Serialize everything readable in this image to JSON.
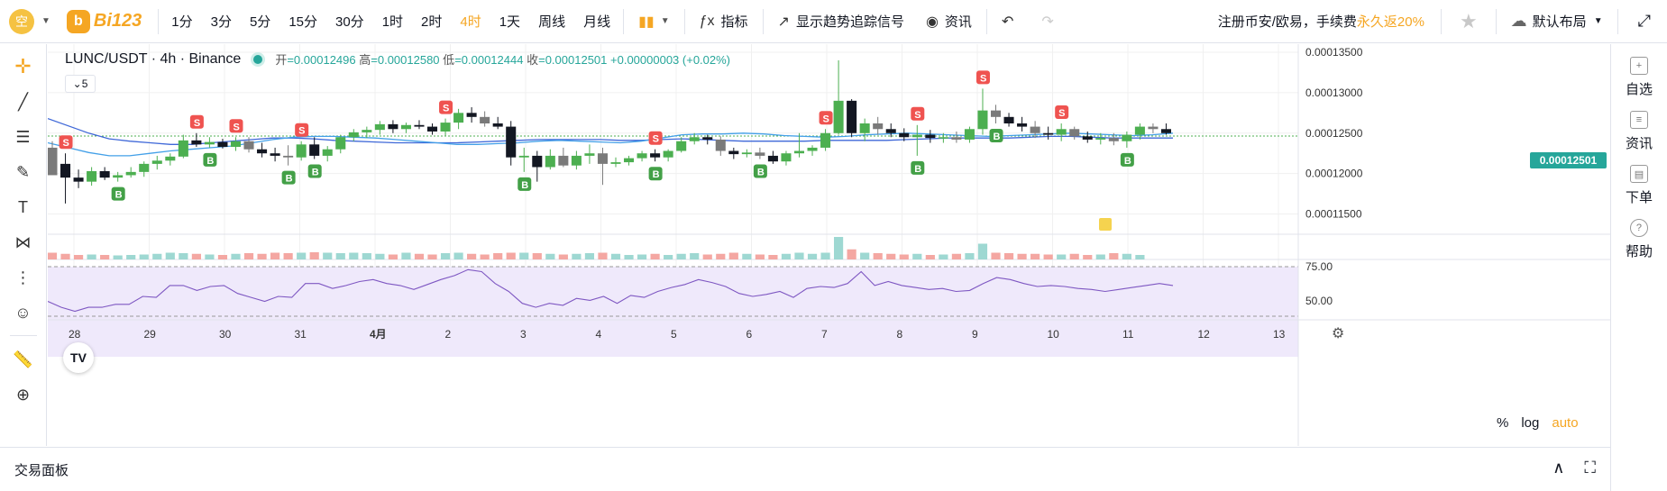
{
  "topbar": {
    "avatar_char": "空",
    "logo_badge": "b",
    "logo_text": "Bi123",
    "intervals": [
      "1分",
      "3分",
      "5分",
      "15分",
      "30分",
      "1时",
      "2时",
      "4时",
      "1天",
      "周线",
      "月线"
    ],
    "active_interval": "4时",
    "indicators_label": "指标",
    "trend_signal_label": "显示趋势追踪信号",
    "news_label": "资讯",
    "promo_text": "注册币安/欧易，手续费",
    "promo_highlight": "永久返20%",
    "layout_label": "默认布局"
  },
  "right_panel": {
    "items": [
      {
        "icon": "add-icon",
        "label": "自选"
      },
      {
        "icon": "news-icon",
        "label": "资讯"
      },
      {
        "icon": "order-icon",
        "label": "下单"
      },
      {
        "icon": "help-icon",
        "label": "帮助"
      }
    ]
  },
  "legend": {
    "symbol": "LUNC/USDT · 4h · Binance",
    "open_label": "开",
    "open": "=0.00012496",
    "high_label": "高",
    "high": "=0.00012580",
    "low_label": "低",
    "low": "=0.00012444",
    "close_label": "收",
    "close": "=0.00012501",
    "change": "+0.00000003 (+0.02%)",
    "ma_toggle": "5"
  },
  "current_price": "0.00012501",
  "bottom": {
    "panel_title": "交易面板",
    "scale_percent": "%",
    "scale_log": "log",
    "scale_auto": "auto",
    "tv_logo": "TV"
  },
  "colors": {
    "up": "#4caf50",
    "down": "#131722",
    "neutral": "#7a7a7a",
    "accent": "#f5a623",
    "sell_badge": "#ef5350",
    "buy_badge": "#43a047"
  },
  "chart_data": {
    "type": "candlestick",
    "symbol": "LUNC/USDT",
    "interval": "4h",
    "exchange": "Binance",
    "price_ticks": [
      "0.00013500",
      "0.00013000",
      "0.00012500",
      "0.00012000",
      "0.00011500"
    ],
    "price_tick_values": [
      0.000135,
      0.00013,
      0.000125,
      0.00012,
      0.000115
    ],
    "rsi_ticks": [
      "75.00",
      "50.00"
    ],
    "x_tick_labels": [
      "28",
      "29",
      "30",
      "31",
      "4月",
      "2",
      "3",
      "4",
      "5",
      "6",
      "7",
      "8",
      "9",
      "10",
      "11",
      "12",
      "13"
    ],
    "ylim": [
      0.0001125,
      0.000136
    ],
    "candles": [
      [
        0.0001232,
        0.000124,
        0.0001212,
        0.0001198
      ],
      [
        0.0001212,
        0.0001225,
        0.0001163,
        0.0001195
      ],
      [
        0.0001195,
        0.0001205,
        0.0001182,
        0.000119
      ],
      [
        0.000119,
        0.0001208,
        0.0001185,
        0.0001203
      ],
      [
        0.0001203,
        0.0001208,
        0.0001192,
        0.0001195
      ],
      [
        0.0001195,
        0.0001202,
        0.000119,
        0.0001198
      ],
      [
        0.0001198,
        0.0001208,
        0.0001195,
        0.0001202
      ],
      [
        0.0001202,
        0.0001215,
        0.0001196,
        0.0001212
      ],
      [
        0.0001212,
        0.0001222,
        0.0001205,
        0.0001216
      ],
      [
        0.0001216,
        0.0001225,
        0.000121,
        0.0001221
      ],
      [
        0.0001221,
        0.0001248,
        0.0001219,
        0.0001241
      ],
      [
        0.0001241,
        0.000125,
        0.0001233,
        0.0001236
      ],
      [
        0.0001236,
        0.0001245,
        0.0001232,
        0.0001239
      ],
      [
        0.0001239,
        0.0001243,
        0.0001231,
        0.0001233
      ],
      [
        0.0001233,
        0.0001245,
        0.0001228,
        0.000124
      ],
      [
        0.000124,
        0.0001245,
        0.0001226,
        0.000123
      ],
      [
        0.000123,
        0.0001238,
        0.000122,
        0.0001225
      ],
      [
        0.0001225,
        0.0001232,
        0.0001215,
        0.0001222
      ],
      [
        0.0001222,
        0.0001235,
        0.000121,
        0.000122
      ],
      [
        0.000122,
        0.000124,
        0.0001216,
        0.0001236
      ],
      [
        0.0001236,
        0.0001245,
        0.0001218,
        0.0001222
      ],
      [
        0.0001222,
        0.0001234,
        0.0001215,
        0.000123
      ],
      [
        0.000123,
        0.0001248,
        0.0001225,
        0.0001245
      ],
      [
        0.0001245,
        0.0001255,
        0.000124,
        0.0001251
      ],
      [
        0.0001251,
        0.0001258,
        0.0001244,
        0.0001254
      ],
      [
        0.0001254,
        0.0001265,
        0.0001248,
        0.0001261
      ],
      [
        0.0001261,
        0.0001266,
        0.000125,
        0.0001255
      ],
      [
        0.0001255,
        0.0001263,
        0.000125,
        0.000126
      ],
      [
        0.000126,
        0.0001266,
        0.0001255,
        0.0001258
      ],
      [
        0.0001258,
        0.0001262,
        0.0001248,
        0.0001252
      ],
      [
        0.0001252,
        0.0001268,
        0.0001247,
        0.0001263
      ],
      [
        0.0001263,
        0.000128,
        0.0001255,
        0.0001275
      ],
      [
        0.0001275,
        0.0001282,
        0.0001263,
        0.000127
      ],
      [
        0.000127,
        0.0001277,
        0.0001258,
        0.0001262
      ],
      [
        0.0001262,
        0.000127,
        0.0001255,
        0.0001258
      ],
      [
        0.0001258,
        0.0001265,
        0.000121,
        0.000122
      ],
      [
        0.000122,
        0.0001232,
        0.0001202,
        0.0001222
      ],
      [
        0.0001222,
        0.0001228,
        0.000119,
        0.0001208
      ],
      [
        0.0001208,
        0.000123,
        0.0001205,
        0.0001222
      ],
      [
        0.0001222,
        0.0001232,
        0.0001208,
        0.000121
      ],
      [
        0.000121,
        0.0001228,
        0.0001205,
        0.0001222
      ],
      [
        0.0001222,
        0.0001236,
        0.0001212,
        0.0001225
      ],
      [
        0.0001225,
        0.0001232,
        0.0001186,
        0.0001212
      ],
      [
        0.0001212,
        0.000122,
        0.0001208,
        0.0001214
      ],
      [
        0.0001214,
        0.0001222,
        0.000121,
        0.0001219
      ],
      [
        0.0001219,
        0.0001228,
        0.0001215,
        0.0001225
      ],
      [
        0.0001225,
        0.000123,
        0.0001215,
        0.000122
      ],
      [
        0.000122,
        0.000123,
        0.0001215,
        0.0001228
      ],
      [
        0.0001228,
        0.0001245,
        0.0001226,
        0.000124
      ],
      [
        0.000124,
        0.000125,
        0.0001236,
        0.0001245
      ],
      [
        0.0001245,
        0.0001248,
        0.0001236,
        0.0001242
      ],
      [
        0.0001242,
        0.0001246,
        0.0001222,
        0.0001228
      ],
      [
        0.0001228,
        0.0001232,
        0.0001218,
        0.0001224
      ],
      [
        0.0001224,
        0.000123,
        0.000122,
        0.0001226
      ],
      [
        0.0001226,
        0.0001232,
        0.0001218,
        0.0001222
      ],
      [
        0.0001222,
        0.0001228,
        0.0001212,
        0.0001215
      ],
      [
        0.0001215,
        0.0001228,
        0.000121,
        0.0001225
      ],
      [
        0.0001225,
        0.000125,
        0.000122,
        0.0001228
      ],
      [
        0.0001228,
        0.0001235,
        0.0001222,
        0.0001232
      ],
      [
        0.0001232,
        0.0001255,
        0.0001228,
        0.000125
      ],
      [
        0.000125,
        0.000134,
        0.0001248,
        0.000129
      ],
      [
        0.000129,
        0.0001292,
        0.0001245,
        0.000125
      ],
      [
        0.000125,
        0.0001268,
        0.000124,
        0.0001262
      ],
      [
        0.0001262,
        0.000127,
        0.0001248,
        0.0001255
      ],
      [
        0.0001255,
        0.0001262,
        0.0001245,
        0.000125
      ],
      [
        0.000125,
        0.0001256,
        0.000124,
        0.0001245
      ],
      [
        0.0001245,
        0.000126,
        0.0001222,
        0.0001248
      ],
      [
        0.0001248,
        0.0001254,
        0.0001238,
        0.0001244
      ],
      [
        0.0001244,
        0.000125,
        0.0001238,
        0.0001245
      ],
      [
        0.0001245,
        0.0001252,
        0.0001238,
        0.0001242
      ],
      [
        0.0001242,
        0.0001258,
        0.0001238,
        0.0001255
      ],
      [
        0.0001255,
        0.0001305,
        0.0001248,
        0.0001278
      ],
      [
        0.0001278,
        0.0001285,
        0.0001262,
        0.000127
      ],
      [
        0.000127,
        0.0001275,
        0.0001258,
        0.0001262
      ],
      [
        0.0001262,
        0.000127,
        0.0001252,
        0.0001258
      ],
      [
        0.0001258,
        0.0001265,
        0.0001244,
        0.000125
      ],
      [
        0.000125,
        0.0001258,
        0.0001242,
        0.0001248
      ],
      [
        0.0001248,
        0.0001262,
        0.000124,
        0.0001255
      ],
      [
        0.0001255,
        0.0001258,
        0.0001242,
        0.0001246
      ],
      [
        0.0001246,
        0.0001252,
        0.0001238,
        0.0001242
      ],
      [
        0.0001242,
        0.000125,
        0.0001236,
        0.0001244
      ],
      [
        0.0001244,
        0.000125,
        0.0001235,
        0.000124
      ],
      [
        0.000124,
        0.0001252,
        0.0001232,
        0.0001248
      ],
      [
        0.0001248,
        0.0001262,
        0.0001242,
        0.0001258
      ],
      [
        0.0001258,
        0.0001262,
        0.000125,
        0.0001255
      ],
      [
        0.0001255,
        0.0001262,
        0.0001248,
        0.000125
      ]
    ],
    "ma_series": [
      {
        "name": "MA slow",
        "values": [
          0.0001268,
          0.0001259,
          0.000125,
          0.0001243,
          0.000124,
          0.0001238,
          0.0001236,
          0.0001236,
          0.0001238,
          0.000124,
          0.0001242,
          0.0001244,
          0.0001244,
          0.0001243,
          0.0001241,
          0.000124,
          0.0001239,
          0.0001238,
          0.0001238,
          0.0001238,
          0.0001238,
          0.0001239,
          0.000124,
          0.0001241,
          0.0001242,
          0.0001242,
          0.0001242,
          0.0001242,
          0.0001241,
          0.0001241,
          0.0001242,
          0.0001243,
          0.0001242,
          0.0001241,
          0.000124,
          0.000124,
          0.000124,
          0.000124,
          0.0001241,
          0.0001241,
          0.0001241,
          0.0001241,
          0.0001242,
          0.0001243,
          0.0001244,
          0.0001244,
          0.0001244,
          0.0001244,
          0.0001245,
          0.0001246,
          0.0001246,
          0.0001245,
          0.0001244,
          0.0001244,
          0.0001244,
          0.0001244
        ]
      },
      {
        "name": "MA fast",
        "values": [
          0.0001238,
          0.0001232,
          0.0001226,
          0.0001222,
          0.0001222,
          0.0001225,
          0.0001228,
          0.000123,
          0.0001232,
          0.0001234,
          0.0001238,
          0.0001242,
          0.0001245,
          0.0001246,
          0.0001246,
          0.0001245,
          0.0001244,
          0.0001242,
          0.000124,
          0.0001238,
          0.0001236,
          0.0001236,
          0.0001237,
          0.0001238,
          0.000124,
          0.0001241,
          0.000124,
          0.0001239,
          0.0001238,
          0.000124,
          0.0001244,
          0.0001248,
          0.0001249,
          0.0001249,
          0.000125,
          0.0001249,
          0.0001247,
          0.0001246,
          0.0001245,
          0.0001246,
          0.0001248,
          0.0001249,
          0.000125,
          0.0001249,
          0.0001248,
          0.0001247,
          0.0001246,
          0.0001247,
          0.0001248,
          0.0001249,
          0.000125,
          0.0001249,
          0.0001248,
          0.0001247,
          0.0001248,
          0.000125
        ]
      }
    ],
    "signals": [
      {
        "type": "S",
        "candle": 1
      },
      {
        "type": "B",
        "candle": 5
      },
      {
        "type": "S",
        "candle": 11
      },
      {
        "type": "B",
        "candle": 12
      },
      {
        "type": "S",
        "candle": 14
      },
      {
        "type": "B",
        "candle": 18
      },
      {
        "type": "S",
        "candle": 19
      },
      {
        "type": "B",
        "candle": 20
      },
      {
        "type": "S",
        "candle": 30
      },
      {
        "type": "B",
        "candle": 36
      },
      {
        "type": "S",
        "candle": 46
      },
      {
        "type": "B",
        "candle": 46
      },
      {
        "type": "B",
        "candle": 54
      },
      {
        "type": "S",
        "candle": 59
      },
      {
        "type": "S",
        "candle": 66
      },
      {
        "type": "B",
        "candle": 66
      },
      {
        "type": "S",
        "candle": 71
      },
      {
        "type": "B",
        "candle": 72
      },
      {
        "type": "S",
        "candle": 77
      },
      {
        "type": "B",
        "candle": 82
      }
    ],
    "volume": [
      0.3,
      0.25,
      0.2,
      0.22,
      0.2,
      0.18,
      0.2,
      0.22,
      0.25,
      0.3,
      0.28,
      0.25,
      0.22,
      0.2,
      0.25,
      0.28,
      0.25,
      0.3,
      0.28,
      0.3,
      0.32,
      0.3,
      0.28,
      0.3,
      0.28,
      0.25,
      0.22,
      0.3,
      0.25,
      0.22,
      0.28,
      0.3,
      0.25,
      0.22,
      0.28,
      0.3,
      0.3,
      0.28,
      0.25,
      0.22,
      0.25,
      0.28,
      0.3,
      0.25,
      0.2,
      0.22,
      0.25,
      0.2,
      0.25,
      0.28,
      0.22,
      0.25,
      0.3,
      0.25,
      0.22,
      0.2,
      0.25,
      0.3,
      0.25,
      0.3,
      1.0,
      0.45,
      0.3,
      0.28,
      0.25,
      0.22,
      0.25,
      0.2,
      0.22,
      0.25,
      0.28,
      0.7,
      0.3,
      0.28,
      0.25,
      0.25,
      0.22,
      0.22,
      0.25,
      0.2,
      0.22,
      0.28,
      0.25,
      0.2
    ],
    "rsi": [
      40,
      34,
      30,
      34,
      34,
      37,
      37,
      45,
      44,
      56,
      56,
      51,
      55,
      56,
      48,
      44,
      40,
      45,
      44,
      58,
      58,
      53,
      56,
      60,
      62,
      58,
      56,
      52,
      57,
      62,
      66,
      72,
      70,
      58,
      50,
      38,
      34,
      38,
      36,
      43,
      41,
      45,
      38,
      46,
      44,
      50,
      54,
      57,
      62,
      59,
      55,
      48,
      45,
      47,
      50,
      44,
      53,
      55,
      54,
      58,
      70,
      56,
      60,
      56,
      54,
      52,
      53,
      50,
      51,
      58,
      64,
      62,
      58,
      55,
      56,
      55,
      53,
      52,
      50,
      52,
      54,
      56,
      58,
      56
    ]
  }
}
